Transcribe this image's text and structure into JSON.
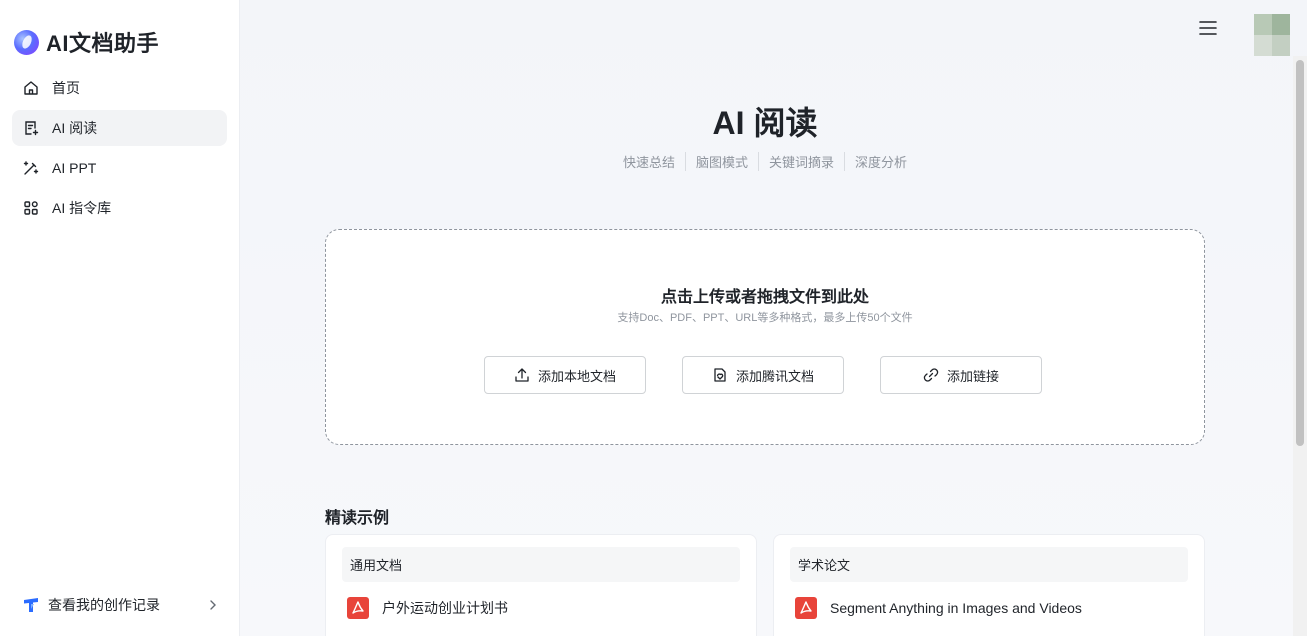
{
  "app": {
    "logo_text": "AI文档助手"
  },
  "sidebar": {
    "items": [
      {
        "label": "首页",
        "icon": "home-icon"
      },
      {
        "label": "AI 阅读",
        "icon": "document-read-icon",
        "active": true
      },
      {
        "label": "AI PPT",
        "icon": "magic-wand-icon"
      },
      {
        "label": "AI 指令库",
        "icon": "grid-apps-icon"
      }
    ],
    "history_label": "查看我的创作记录"
  },
  "header": {
    "menu_icon": "hamburger-menu-icon",
    "avatar_icon": "user-avatar"
  },
  "main": {
    "title": "AI 阅读",
    "tags": [
      "快速总结",
      "脑图模式",
      "关键词摘录",
      "深度分析"
    ],
    "upload": {
      "title": "点击上传或者拖拽文件到此处",
      "subtitle": "支持Doc、PDF、PPT、URL等多种格式，最多上传50个文件",
      "buttons": {
        "local": "添加本地文档",
        "tencent": "添加腾讯文档",
        "link": "添加链接"
      }
    },
    "examples": {
      "title": "精读示例",
      "cards": [
        {
          "header": "通用文档",
          "file": "户外运动创业计划书",
          "file_icon": "pdf-icon"
        },
        {
          "header": "学术论文",
          "file": "Segment Anything in Images and Videos",
          "file_icon": "pdf-icon"
        }
      ]
    }
  },
  "colors": {
    "text": "#1f2329",
    "muted": "#8f959e",
    "pdf_red": "#e8443a",
    "brand_blue": "#2b6cff"
  }
}
